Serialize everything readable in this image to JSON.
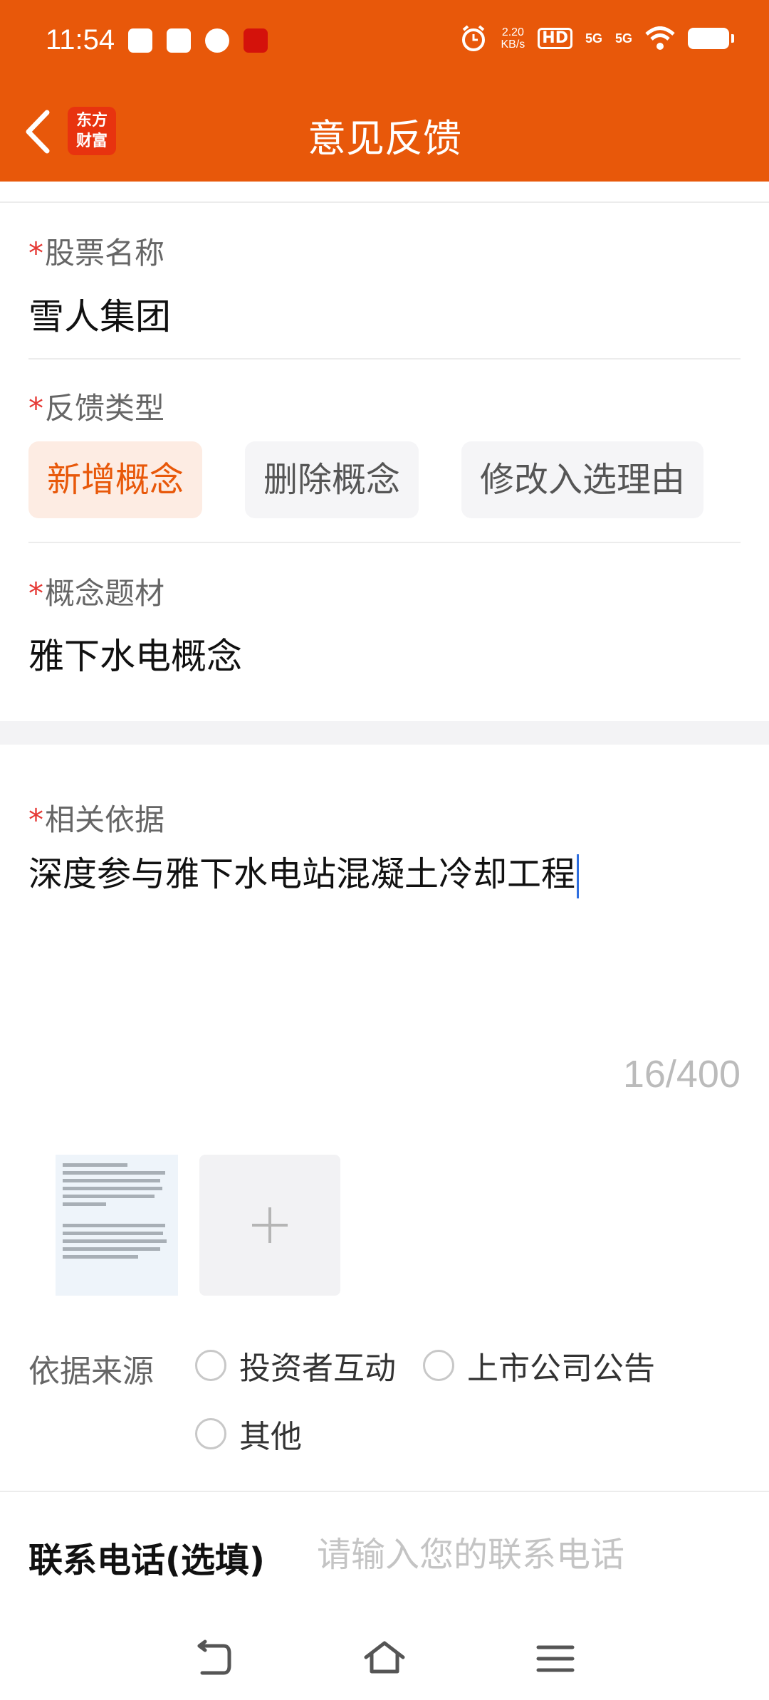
{
  "status_bar": {
    "time": "11:54",
    "net_speed_value": "2.20",
    "net_speed_unit": "KB/s",
    "hd_label": "HD",
    "signal_1": "5G",
    "signal_2": "5G"
  },
  "header": {
    "title": "意见反馈",
    "logo_line1": "东方",
    "logo_line2": "财富",
    "accent_color": "#e8580a"
  },
  "form": {
    "required_mark": "*",
    "stock_name": {
      "label": "股票名称",
      "value": "雪人集团"
    },
    "feedback_type": {
      "label": "反馈类型",
      "options": [
        "新增概念",
        "删除概念",
        "修改入选理由"
      ],
      "selected_index": 0
    },
    "concept": {
      "label": "概念题材",
      "value": "雅下水电概念"
    },
    "basis": {
      "label": "相关依据",
      "value": "深度参与雅下水电站混凝土冷却工程",
      "counter": "16/400"
    },
    "source": {
      "label": "依据来源",
      "options": [
        "投资者互动",
        "上市公司公告",
        "其他"
      ]
    },
    "phone": {
      "label": "联系电话(选填)",
      "placeholder": "请输入您的联系电话"
    }
  },
  "icons": {
    "back": "back-arrow-icon",
    "add_image": "plus-icon",
    "nav_back": "nav-back-icon",
    "nav_home": "home-icon",
    "nav_menu": "menu-icon"
  }
}
